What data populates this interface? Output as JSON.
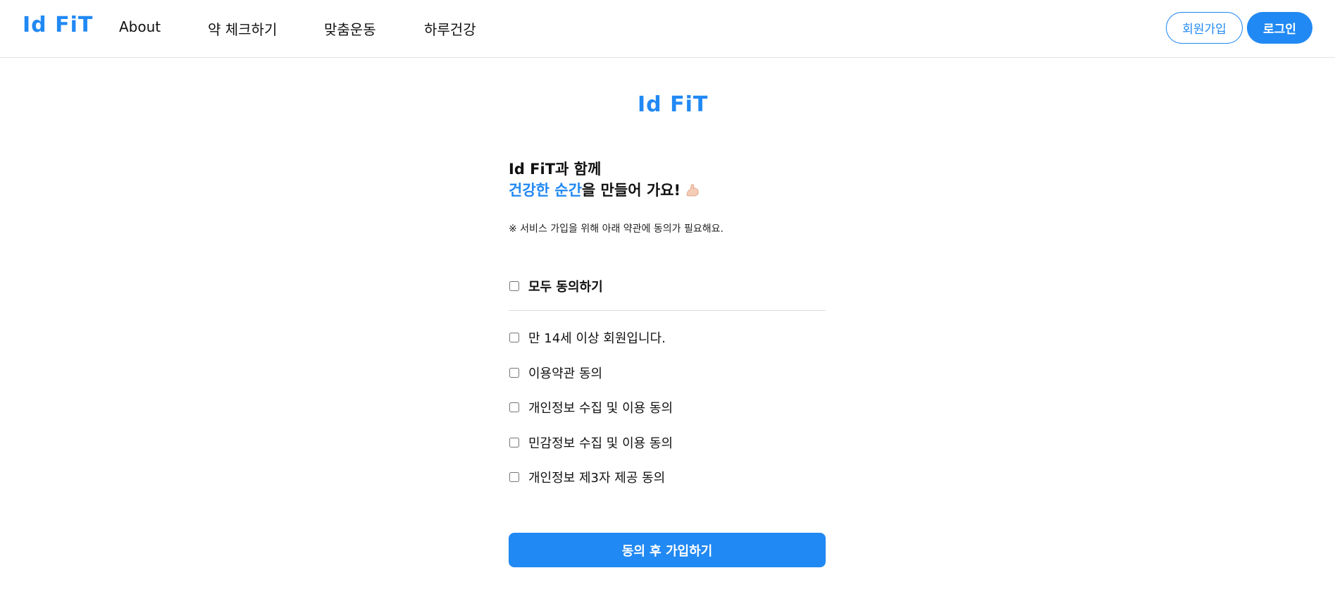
{
  "header": {
    "logo": "Id FiT",
    "nav": [
      {
        "label": "About"
      },
      {
        "label": "약 체크하기"
      },
      {
        "label": "맞춤운동"
      },
      {
        "label": "하루건강"
      }
    ],
    "signup_label": "회원가입",
    "login_label": "로그인"
  },
  "main": {
    "logo": "Id FiT",
    "headline_line1": "Id FiT과 함께",
    "headline_accent": "건강한 순간",
    "headline_rest": "을 만들어 가요!",
    "headline_icon": "flexed-biceps-icon",
    "notice": "※ 서비스 가입을 위해 아래 약관에 동의가 필요해요.",
    "agree_all_label": "모두 동의하기",
    "terms": [
      {
        "label": "만 14세 이상 회원입니다.",
        "checked": false
      },
      {
        "label": "이용약관 동의",
        "checked": false
      },
      {
        "label": "개인정보 수집 및 이용 동의",
        "checked": false
      },
      {
        "label": "민감정보 수집 및 이용 동의",
        "checked": false
      },
      {
        "label": "개인정보 제3자 제공 동의",
        "checked": false
      }
    ],
    "submit_label": "동의 후 가입하기"
  },
  "colors": {
    "accent": "#2189f3",
    "divider": "#dcdcdc"
  }
}
